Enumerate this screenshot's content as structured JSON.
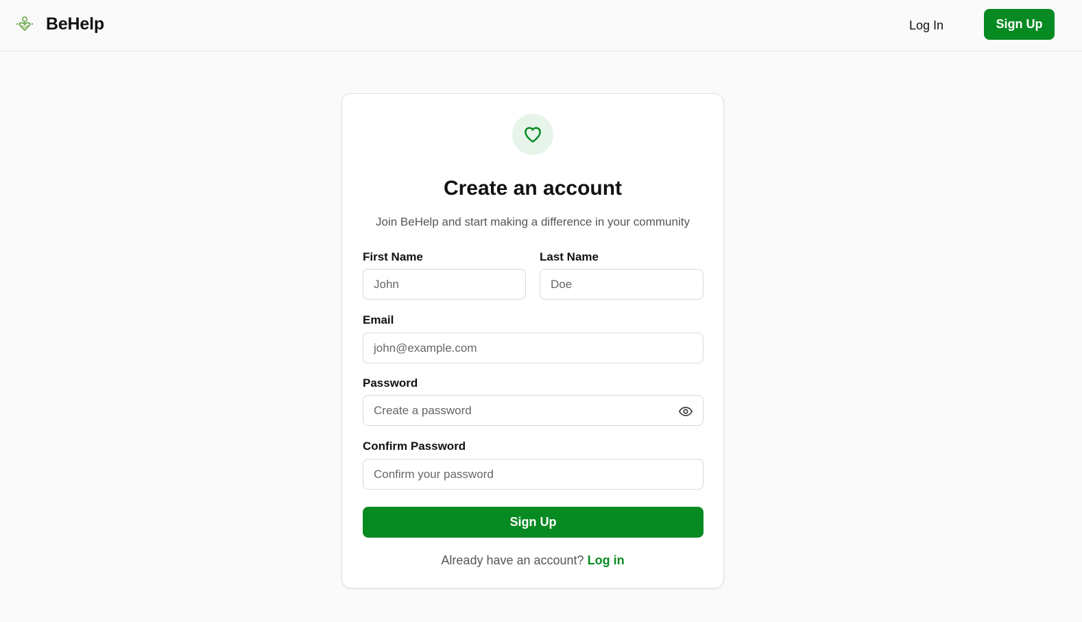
{
  "colors": {
    "accent": "#078a22",
    "badge_bg": "#e6f4ea",
    "page_bg": "#fafafa"
  },
  "header": {
    "brand": "BeHelp",
    "login_label": "Log In",
    "signup_label": "Sign Up"
  },
  "form": {
    "title": "Create an account",
    "subtitle": "Join BeHelp and start making a difference in your community",
    "first_name": {
      "label": "First Name",
      "placeholder": "John"
    },
    "last_name": {
      "label": "Last Name",
      "placeholder": "Doe"
    },
    "email": {
      "label": "Email",
      "placeholder": "john@example.com"
    },
    "password": {
      "label": "Password",
      "placeholder": "Create a password"
    },
    "confirm_password": {
      "label": "Confirm Password",
      "placeholder": "Confirm your password"
    },
    "submit_label": "Sign Up",
    "footer_text": "Already have an account?",
    "footer_link": "Log in"
  }
}
